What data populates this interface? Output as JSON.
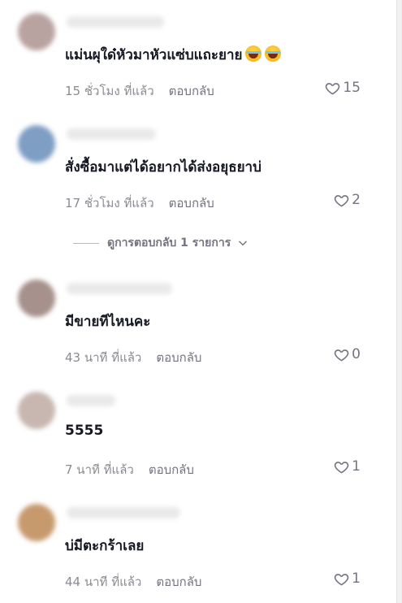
{
  "comments": [
    {
      "text": "แม่นผุใด๋หัวมาหัวแซ่บแถะยาย",
      "emoji_count": 2,
      "time": "15 ชั่วโมง ที่แล้ว",
      "reply_label": "ตอบกลับ",
      "likes": "15",
      "avatar_color": "#b9a3a0"
    },
    {
      "text": "สั่งซื้อมาแต่ได้อยากได้ส่งอยุธยาบ่",
      "time": "17 ชั่วโมง ที่แล้ว",
      "reply_label": "ตอบกลับ",
      "likes": "2",
      "avatar_color": "#7f9ec4"
    },
    {
      "text": "มีขายทีไหนคะ",
      "time": "43 นาที ที่แล้ว",
      "reply_label": "ตอบกลับ",
      "likes": "0",
      "avatar_color": "#a6918c"
    },
    {
      "text": "5555",
      "time": "7 นาที ที่แล้ว",
      "reply_label": "ตอบกลับ",
      "likes": "1",
      "avatar_color": "#c7b7b0"
    },
    {
      "text": "บ่มีตะกร้าเลย",
      "time": "44 นาที ที่แล้ว",
      "reply_label": "ตอบกลับ",
      "likes": "1",
      "avatar_color": "#c79a6e"
    }
  ],
  "view_replies_label": "ดูการตอบกลับ 1 รายการ"
}
